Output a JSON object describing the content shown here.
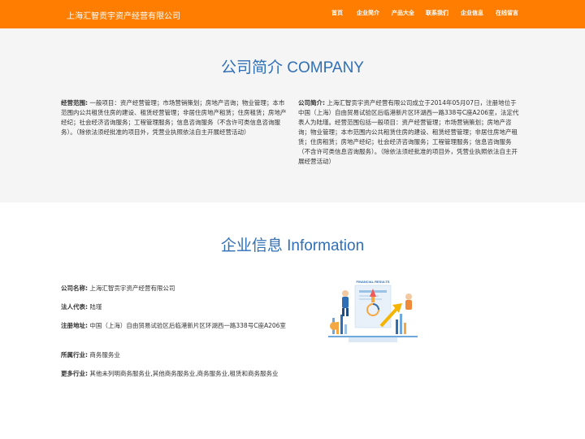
{
  "header": {
    "brand": "上海汇智贡宇资产经营有限公司",
    "nav": [
      "首页",
      "企业简介",
      "产品大全",
      "联系我们",
      "企业信息",
      "在线留言"
    ],
    "bg_color": "#ff7d00"
  },
  "about": {
    "title": "公司简介 COMPANY",
    "scope_label": "经营范围:",
    "scope_text": "一般项目：资产经营管理；市场营销策划；房地产咨询；物业管理；本市范围内公共租赁住房的建设、租赁经营管理；非居住房地产租赁；住房租赁；房地产经纪；社会经济咨询服务；工程管理服务；信息咨询服务（不含许可类信息咨询服务）。（除依法须经批准的项目外，凭营业执照依法自主开展经营活动）",
    "intro_label": "公司简介:",
    "intro_text": "上海汇智贡宇资产经营有限公司成立于2014年05月07日，注册地位于中国（上海）自由贸易试验区后临港新片区环湖西一路338号C座A206室，法定代表人为陆瑾。经营范围包括一般项目：资产经营管理；市场营销策划；房地产咨询；物业管理；本市范围内公共租赁住房的建设、租赁经营管理；非居住房地产租赁；住房租赁；房地产经纪；社会经济咨询服务；工程管理服务；信息咨询服务（不含许可类信息咨询服务）。（除依法须经批准的项目外，凭营业执照依法自主开展经营活动）"
  },
  "info": {
    "title": "企业信息 Information",
    "rows": [
      {
        "label": "公司名称:",
        "value": "上海汇智贡宇资产经营有限公司"
      },
      {
        "label": "法人代表:",
        "value": "陆瑾"
      },
      {
        "label": "注册地址:",
        "value": "中国（上海）自由贸易试验区后临港新片区环湖西一路338号C座A206室"
      },
      {
        "label": "所属行业:",
        "value": "商务服务业"
      },
      {
        "label": "更多行业:",
        "value": "其他未列明商务服务业,其他商务服务业,商务服务业,租赁和商务服务业"
      }
    ],
    "illustration_caption": "FINANCIAL RESULTS",
    "accent_color": "#2f6fb6"
  }
}
